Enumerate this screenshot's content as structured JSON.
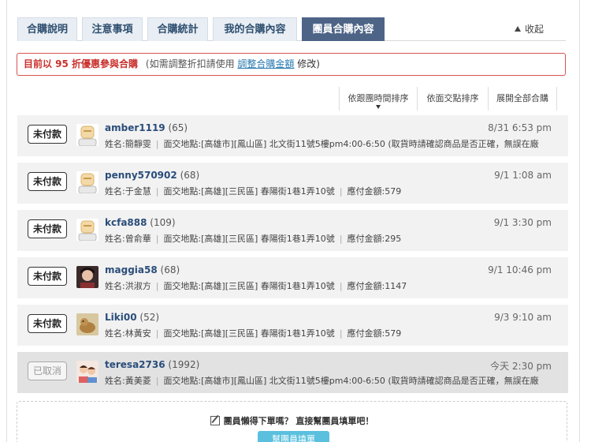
{
  "tabs": [
    {
      "label": "合購說明"
    },
    {
      "label": "注意事項"
    },
    {
      "label": "合購統計"
    },
    {
      "label": "我的合購內容"
    },
    {
      "label": "團員合購內容"
    }
  ],
  "collapse_label": "收起",
  "notice": {
    "emphasis": "目前以 95 折優惠參與合購",
    "sub_prefix": "(如需調整折扣請使用",
    "link": "調整合購金額",
    "sub_suffix": "修改)"
  },
  "sort_options": [
    "依跟團時間排序",
    "依面交點排序",
    "展開全部合購"
  ],
  "orders": [
    {
      "status": "未付款",
      "cancelled": false,
      "username": "amber1119",
      "score": "(65)",
      "time": "8/31 6:53 pm",
      "name": "姓名:簡靜雯",
      "location": "面交地點:[高雄市][鳳山區] 北文街11號5樓pm4:00-6:50",
      "extra": "(取貨時請確認商品是否正確，無誤在廠",
      "avatar": "default-avatar-icon"
    },
    {
      "status": "未付款",
      "cancelled": false,
      "username": "penny570902",
      "score": "(68)",
      "time": "9/1 1:08 am",
      "name": "姓名:于金慧",
      "location": "面交地點:[高雄][三民區] 春陽街1巷1弄10號",
      "extra": "應付金額:579",
      "avatar": "default-avatar-icon"
    },
    {
      "status": "未付款",
      "cancelled": false,
      "username": "kcfa888",
      "score": "(109)",
      "time": "9/1 3:30 pm",
      "name": "姓名:曾俞華",
      "location": "面交地點:[高雄][三民區] 春陽街1巷1弄10號",
      "extra": "應付金額:295",
      "avatar": "default-avatar-icon"
    },
    {
      "status": "未付款",
      "cancelled": false,
      "username": "maggia58",
      "score": "(68)",
      "time": "9/1 10:46 pm",
      "name": "姓名:洪淑方",
      "location": "面交地點:[高雄][三民區] 春陽街1巷1弄10號",
      "extra": "應付金額:1147",
      "avatar": "photo-avatar-icon"
    },
    {
      "status": "未付款",
      "cancelled": false,
      "username": "Liki00",
      "score": "(52)",
      "time": "9/3 9:10 am",
      "name": "姓名:林黃安",
      "location": "面交地點:[高雄][三民區] 春陽街1巷1弄10號",
      "extra": "應付金額:579",
      "avatar": "pet-avatar-icon"
    },
    {
      "status": "已取消",
      "cancelled": true,
      "username": "teresa2736",
      "score": "(1992)",
      "time": "今天 2:30 pm",
      "name": "姓名:黃美菱",
      "location": "面交地點:[高雄市][鳳山區] 北文街11號5樓pm4:00-6:50",
      "extra": "(取貨時請確認商品是否正確，無誤在廠",
      "avatar": "kids-avatar-icon"
    }
  ],
  "help": {
    "text": "團員懶得下單嗎？ 直接幫團員填單吧！",
    "button": "幫團員填單"
  },
  "colors": {
    "active_tab": "#4d6487",
    "tab_bg": "#e8eef4",
    "notice_border": "#d9534f",
    "button": "#5bc0de"
  }
}
